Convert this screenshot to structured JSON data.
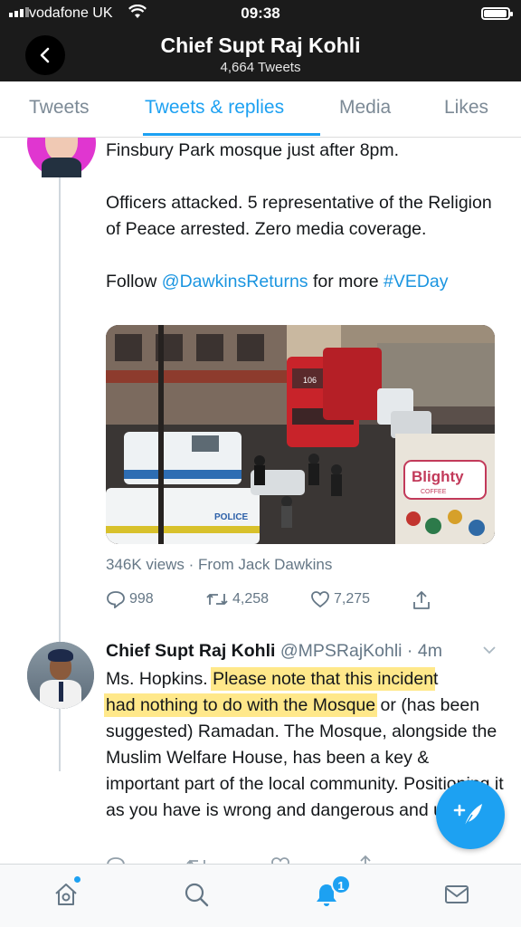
{
  "status_bar": {
    "carrier": "vodafone UK",
    "time": "09:38",
    "battery_level": 0.95
  },
  "header": {
    "title": "Chief Supt Raj Kohli",
    "subtitle": "4,664 Tweets"
  },
  "tabs": [
    {
      "label": "Tweets",
      "active": false
    },
    {
      "label": "Tweets & replies",
      "active": true
    },
    {
      "label": "Media",
      "active": false
    },
    {
      "label": "Likes",
      "active": false
    }
  ],
  "tweet1": {
    "line1": "Finsbury Park mosque just after 8pm.",
    "para2": "Officers attacked. 5 representative of the Religion of Peace arrested. Zero media coverage.",
    "follow_prefix": "Follow ",
    "mention": "@DawkinsReturns",
    "follow_middle": " for more ",
    "hashtag": "#VEDay",
    "media_sign_text": "Blighty",
    "media_sign_sub": "COFFEE",
    "media_bus_number": "106",
    "media_police_text": "POLICE",
    "meta": "346K views · From Jack Dawkins",
    "replies": "998",
    "retweets": "4,258",
    "likes": "7,275"
  },
  "tweet2": {
    "name": "Chief Supt Raj Kohli",
    "handle": "@MPSRajKohli · 4m",
    "text_a": "Ms. Hopkins. ",
    "highlight_1": "Please note that this inciden",
    "text_b": "t",
    "highlight_2": "had nothing to do with the Mosque",
    "text_c": " or (has been suggested) Ramadan. The Mosque, alongside the Muslim Welfare House, has been a key & important part of the local community. Positioning it as you have is wrong and dangerous and untrue."
  },
  "bottom_nav": {
    "notifications_count": "1"
  },
  "icons": {
    "back": "chevron-left-icon",
    "compose": "compose-feather-icon",
    "home": "home-icon",
    "search": "search-icon",
    "notifications": "bell-icon",
    "messages": "mail-icon"
  },
  "colors": {
    "accent": "#1da1f2",
    "link": "#1b95e0",
    "highlight": "#ffe88a",
    "header_bg": "#1b1b1b"
  }
}
